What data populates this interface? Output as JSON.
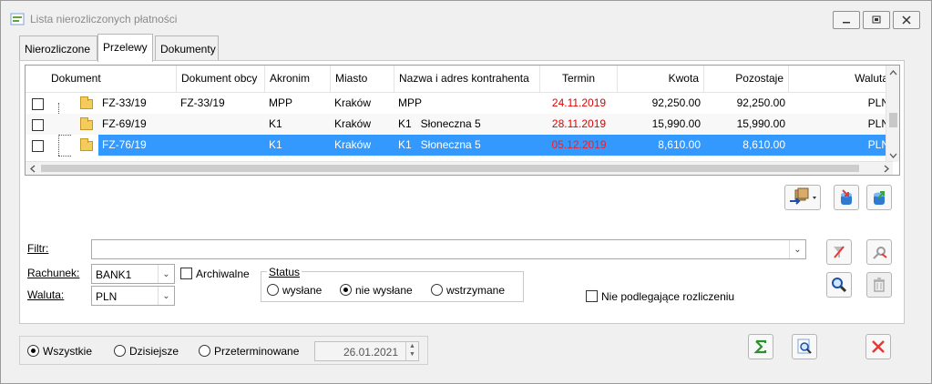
{
  "window": {
    "title": "Lista nierozliczonych płatności"
  },
  "tabs": [
    {
      "label": "Nierozliczone"
    },
    {
      "label": "Przelewy"
    },
    {
      "label": "Dokumenty"
    }
  ],
  "table": {
    "headers": [
      "Dokument",
      "Dokument obcy",
      "Akronim",
      "Miasto",
      "Nazwa i adres kontrahenta",
      "Termin",
      "Kwota",
      "Pozostaje",
      "Waluta"
    ],
    "rows": [
      {
        "dokument": "FZ-33/19",
        "dokument_obcy": "FZ-33/19",
        "akronim": "MPP",
        "miasto": "Kraków",
        "nazwa": "MPP",
        "termin": "24.11.2019",
        "kwota": "92,250.00",
        "pozostaje": "92,250.00",
        "waluta": "PLN"
      },
      {
        "dokument": "FZ-69/19",
        "dokument_obcy": "",
        "akronim": "K1",
        "miasto": "Kraków",
        "nazwa": "K1   Słoneczna 5",
        "termin": "28.11.2019",
        "kwota": "15,990.00",
        "pozostaje": "15,990.00",
        "waluta": "PLN"
      },
      {
        "dokument": "FZ-76/19",
        "dokument_obcy": "",
        "akronim": "K1",
        "miasto": "Kraków",
        "nazwa": "K1   Słoneczna 5",
        "termin": "05.12.2019",
        "kwota": "8,610.00",
        "pozostaje": "8,610.00",
        "waluta": "PLN"
      }
    ]
  },
  "filters": {
    "filtr_label": "Filtr:",
    "filtr_value": "",
    "rachunek_label": "Rachunek:",
    "rachunek_value": "BANK1",
    "waluta_label": "Waluta:",
    "waluta_value": "PLN",
    "archiwalne_label": "Archiwalne",
    "status_label": "Status",
    "status_options": [
      "wysłane",
      "nie wysłane",
      "wstrzymane"
    ],
    "status_selected": "nie wysłane",
    "nie_podlegajace_label": "Nie podlegające rozliczeniu"
  },
  "date_filter": {
    "options": [
      "Wszystkie",
      "Dzisiejsze",
      "Przeterminowane"
    ],
    "selected": "Wszystkie",
    "date_value": "26.01.2021"
  },
  "colors": {
    "selection": "#3399ff",
    "overdue_date": "#e00000",
    "close_icon": "#e53935"
  }
}
